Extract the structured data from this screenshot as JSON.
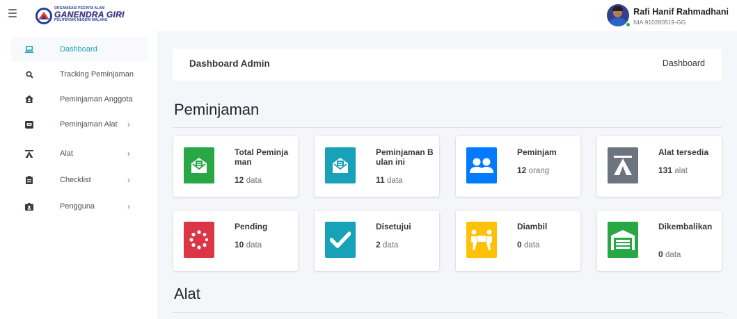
{
  "brand": {
    "org_small": "ORGANISASI PECINTA ALAM",
    "org_name": "GANENDRA GIRI",
    "org_sub": "POLITEKNIK NEGERI MALANG"
  },
  "user": {
    "name": "Rafi Hanif Rahmadhani",
    "nia": "NIA.910280519-GG"
  },
  "sidebar": {
    "items": [
      {
        "label": "Dashboard",
        "icon": "laptop-icon"
      },
      {
        "label": "Tracking Peminjaman",
        "icon": "search-icon"
      },
      {
        "label": "Peminjaman Anggota",
        "icon": "home-user-icon"
      },
      {
        "label": "Peminjaman Alat",
        "icon": "archive-icon"
      },
      {
        "label": "Alat",
        "icon": "tent-icon"
      },
      {
        "label": "Checklist",
        "icon": "clipboard-icon"
      },
      {
        "label": "Pengguna",
        "icon": "id-badge-icon"
      }
    ]
  },
  "header": {
    "title": "Dashboard Admin",
    "breadcrumb": "Dashboard"
  },
  "sections": {
    "peminjaman": "Peminjaman",
    "alat": "Alat"
  },
  "cards": [
    {
      "title": "Total Peminjaman",
      "value": "12",
      "unit": "data",
      "color": "#28a745",
      "icon": "envelope-open-icon"
    },
    {
      "title": "Peminjaman Bulan ini",
      "value": "11",
      "unit": "data",
      "color": "#17a2b8",
      "icon": "envelope-open-icon"
    },
    {
      "title": "Peminjam",
      "value": "12",
      "unit": "orang",
      "color": "#007bff",
      "icon": "users-icon"
    },
    {
      "title": "Alat tersedia",
      "value": "131",
      "unit": "alat",
      "color": "#6c757d",
      "icon": "tent-icon"
    },
    {
      "title": "Pending",
      "value": "10",
      "unit": "data",
      "color": "#dc3545",
      "icon": "spinner-icon"
    },
    {
      "title": "Disetujui",
      "value": "2",
      "unit": "data",
      "color": "#17a2b8",
      "icon": "check-icon"
    },
    {
      "title": "Diambil",
      "value": "0",
      "unit": "data",
      "color": "#ffc107",
      "icon": "people-carry-icon"
    },
    {
      "title": "Dikembalikan",
      "value": "0",
      "unit": "data",
      "color": "#28a745",
      "icon": "warehouse-icon"
    }
  ]
}
